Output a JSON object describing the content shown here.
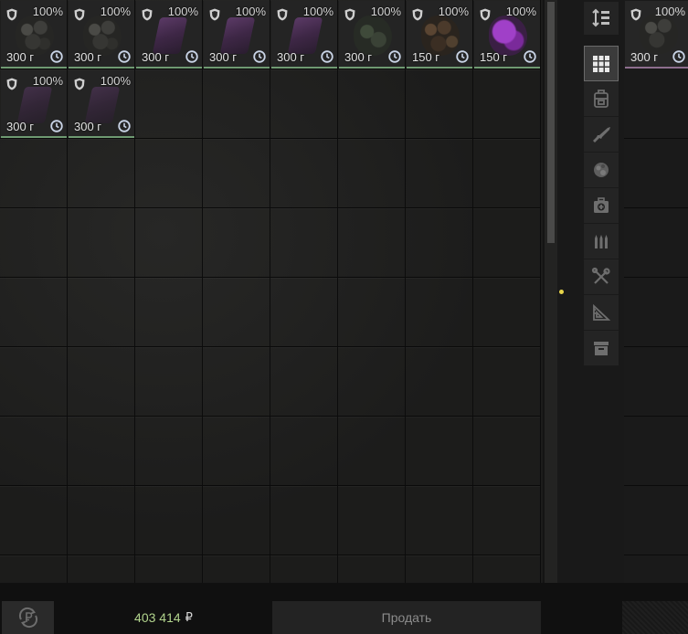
{
  "inventory": {
    "columns": 8,
    "rows": 8,
    "items": [
      {
        "col": 0,
        "row": 0,
        "durability": "100%",
        "weight": "300 г",
        "art": "stones"
      },
      {
        "col": 1,
        "row": 0,
        "durability": "100%",
        "weight": "300 г",
        "art": "stones"
      },
      {
        "col": 2,
        "row": 0,
        "durability": "100%",
        "weight": "300 г",
        "art": "crystal"
      },
      {
        "col": 3,
        "row": 0,
        "durability": "100%",
        "weight": "300 г",
        "art": "crystal"
      },
      {
        "col": 4,
        "row": 0,
        "durability": "100%",
        "weight": "300 г",
        "art": "crystal"
      },
      {
        "col": 5,
        "row": 0,
        "durability": "100%",
        "weight": "300 г",
        "art": "mossy"
      },
      {
        "col": 6,
        "row": 0,
        "durability": "100%",
        "weight": "150 г",
        "art": "brown"
      },
      {
        "col": 7,
        "row": 0,
        "durability": "100%",
        "weight": "150 г",
        "art": "purple"
      },
      {
        "col": 0,
        "row": 1,
        "durability": "100%",
        "weight": "300 г",
        "art": "crystal-dim"
      },
      {
        "col": 1,
        "row": 1,
        "durability": "100%",
        "weight": "300 г",
        "art": "crystal-dim"
      }
    ]
  },
  "sidebar": {
    "sort_icon": "sort-vertical-icon",
    "filters": [
      {
        "name": "filter-all",
        "icon": "grid-icon",
        "active": true
      },
      {
        "name": "filter-backpacks",
        "icon": "backpack-icon",
        "active": false
      },
      {
        "name": "filter-weapons",
        "icon": "rifle-icon",
        "active": false
      },
      {
        "name": "filter-artifacts",
        "icon": "artifact-icon",
        "active": false
      },
      {
        "name": "filter-medicine",
        "icon": "medkit-icon",
        "active": false
      },
      {
        "name": "filter-ammo",
        "icon": "ammo-icon",
        "active": false
      },
      {
        "name": "filter-tools",
        "icon": "tools-icon",
        "active": false
      },
      {
        "name": "filter-misc",
        "icon": "triangle-ruler-icon",
        "active": false
      },
      {
        "name": "filter-storage",
        "icon": "archive-box-icon",
        "active": false
      }
    ]
  },
  "right_panel": {
    "item": {
      "durability": "100%",
      "weight": "300 г",
      "art": "stones"
    }
  },
  "bottom_bar": {
    "currency_icon": "ruble-refresh-icon",
    "balance": "403 414",
    "currency_symbol": "₽",
    "sell_label": "Продать"
  },
  "colors": {
    "item_border": "#6f9a72",
    "right_item_border": "#8d6e8e",
    "balance_text": "#b2d48d",
    "marker": "#e7d54a"
  }
}
